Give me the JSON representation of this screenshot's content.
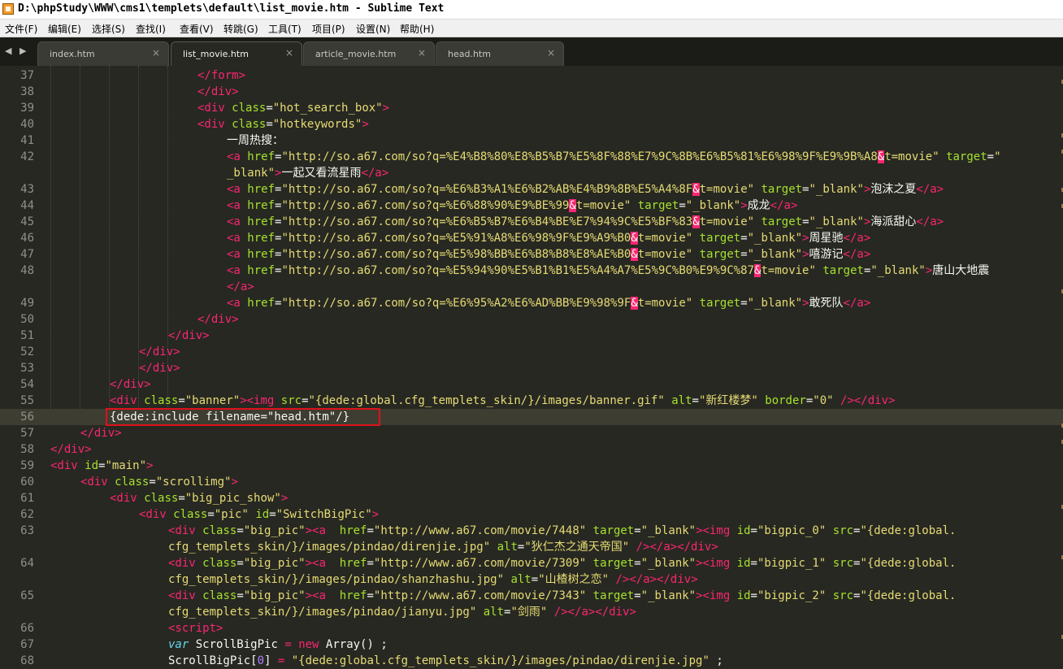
{
  "window": {
    "title": "D:\\phpStudy\\WWW\\cms1\\templets\\default\\list_movie.htm - Sublime Text"
  },
  "menu": {
    "items": [
      "文件(F)",
      "编辑(E)",
      "选择(S)",
      "查找(I)",
      "查看(V)",
      "转跳(G)",
      "工具(T)",
      "项目(P)",
      "设置(N)",
      "帮助(H)"
    ]
  },
  "tabs": [
    {
      "label": "index.htm",
      "active": false
    },
    {
      "label": "list_movie.htm",
      "active": true
    },
    {
      "label": "article_movie.htm",
      "active": false
    },
    {
      "label": "head.htm",
      "active": false
    }
  ],
  "icons": {
    "app": "sublime-text-icon",
    "tab_close": "close-icon",
    "nav": "tab-nav-arrows-icon"
  },
  "colors": {
    "background": "#272822",
    "tag": "#f92672",
    "attribute": "#a6e22e",
    "string": "#e6db74",
    "keyword": "#66d9ef",
    "number": "#ae81ff",
    "highlight_box": "#e0101a"
  },
  "editor": {
    "highlighted_line": 56,
    "line_numbers": [
      "37",
      "38",
      "39",
      "40",
      "41",
      "42",
      "",
      "43",
      "44",
      "45",
      "46",
      "47",
      "48",
      "",
      "49",
      "50",
      "51",
      "52",
      "53",
      "54",
      "55",
      "56",
      "57",
      "58",
      "59",
      "60",
      "61",
      "62",
      "63",
      "",
      "64",
      "",
      "65",
      "",
      "66",
      "67",
      "68"
    ],
    "rows": [
      [
        [
          "t",
          "</form>"
        ]
      ],
      [
        [
          "t",
          "</div>"
        ]
      ],
      [
        [
          "t",
          "<div "
        ],
        [
          "a",
          "class"
        ],
        [
          "",
          "="
        ],
        [
          "s",
          "\"hot_search_box\""
        ],
        [
          "t",
          ">"
        ]
      ],
      [
        [
          "t",
          "<div "
        ],
        [
          "a",
          "class"
        ],
        [
          "",
          "="
        ],
        [
          "s",
          "\"hotkeywords\""
        ],
        [
          "t",
          ">"
        ]
      ],
      [
        [
          "",
          "一周热搜："
        ]
      ],
      [
        [
          "t",
          "<a "
        ],
        [
          "a",
          "href"
        ],
        [
          "",
          "="
        ],
        [
          "s",
          "\"http://so.a67.com/so?q=%E4%B8%80%E8%B5%B7%E5%8F%88%E7%9C%8B%E6%B5%81%E6%98%9F%E9%9B%A8"
        ],
        [
          "err",
          "&"
        ],
        [
          "s",
          "t=movie\""
        ],
        [
          "",
          " "
        ],
        [
          "a",
          "target"
        ],
        [
          "",
          "="
        ],
        [
          "s",
          "\""
        ]
      ],
      [
        [
          "s",
          "_blank\""
        ],
        [
          "t",
          ">"
        ],
        [
          "",
          "一起又看流星雨"
        ],
        [
          "t",
          "</a>"
        ]
      ],
      [
        [
          "t",
          "<a "
        ],
        [
          "a",
          "href"
        ],
        [
          "",
          "="
        ],
        [
          "s",
          "\"http://so.a67.com/so?q=%E6%B3%A1%E6%B2%AB%E4%B9%8B%E5%A4%8F"
        ],
        [
          "err",
          "&"
        ],
        [
          "s",
          "t=movie\""
        ],
        [
          "",
          " "
        ],
        [
          "a",
          "target"
        ],
        [
          "",
          "="
        ],
        [
          "s",
          "\"_blank\""
        ],
        [
          "t",
          ">"
        ],
        [
          "",
          "泡沫之夏"
        ],
        [
          "t",
          "</a>"
        ]
      ],
      [
        [
          "t",
          "<a "
        ],
        [
          "a",
          "href"
        ],
        [
          "",
          "="
        ],
        [
          "s",
          "\"http://so.a67.com/so?q=%E6%88%90%E9%BE%99"
        ],
        [
          "err",
          "&"
        ],
        [
          "s",
          "t=movie\""
        ],
        [
          "",
          " "
        ],
        [
          "a",
          "target"
        ],
        [
          "",
          "="
        ],
        [
          "s",
          "\"_blank\""
        ],
        [
          "t",
          ">"
        ],
        [
          "",
          "成龙"
        ],
        [
          "t",
          "</a>"
        ]
      ],
      [
        [
          "t",
          "<a "
        ],
        [
          "a",
          "href"
        ],
        [
          "",
          "="
        ],
        [
          "s",
          "\"http://so.a67.com/so?q=%E6%B5%B7%E6%B4%BE%E7%94%9C%E5%BF%83"
        ],
        [
          "err",
          "&"
        ],
        [
          "s",
          "t=movie\""
        ],
        [
          "",
          " "
        ],
        [
          "a",
          "target"
        ],
        [
          "",
          "="
        ],
        [
          "s",
          "\"_blank\""
        ],
        [
          "t",
          ">"
        ],
        [
          "",
          "海派甜心"
        ],
        [
          "t",
          "</a>"
        ]
      ],
      [
        [
          "t",
          "<a "
        ],
        [
          "a",
          "href"
        ],
        [
          "",
          "="
        ],
        [
          "s",
          "\"http://so.a67.com/so?q=%E5%91%A8%E6%98%9F%E9%A9%B0"
        ],
        [
          "err",
          "&"
        ],
        [
          "s",
          "t=movie\""
        ],
        [
          "",
          " "
        ],
        [
          "a",
          "target"
        ],
        [
          "",
          "="
        ],
        [
          "s",
          "\"_blank\""
        ],
        [
          "t",
          ">"
        ],
        [
          "",
          "周星驰"
        ],
        [
          "t",
          "</a>"
        ]
      ],
      [
        [
          "t",
          "<a "
        ],
        [
          "a",
          "href"
        ],
        [
          "",
          "="
        ],
        [
          "s",
          "\"http://so.a67.com/so?q=%E5%98%BB%E6%B8%B8%E8%AE%B0"
        ],
        [
          "err",
          "&"
        ],
        [
          "s",
          "t=movie\""
        ],
        [
          "",
          " "
        ],
        [
          "a",
          "target"
        ],
        [
          "",
          "="
        ],
        [
          "s",
          "\"_blank\""
        ],
        [
          "t",
          ">"
        ],
        [
          "",
          "嘻游记"
        ],
        [
          "t",
          "</a>"
        ]
      ],
      [
        [
          "t",
          "<a "
        ],
        [
          "a",
          "href"
        ],
        [
          "",
          "="
        ],
        [
          "s",
          "\"http://so.a67.com/so?q=%E5%94%90%E5%B1%B1%E5%A4%A7%E5%9C%B0%E9%9C%87"
        ],
        [
          "err",
          "&"
        ],
        [
          "s",
          "t=movie\""
        ],
        [
          "",
          " "
        ],
        [
          "a",
          "target"
        ],
        [
          "",
          "="
        ],
        [
          "s",
          "\"_blank\""
        ],
        [
          "t",
          ">"
        ],
        [
          "",
          "唐山大地震"
        ]
      ],
      [
        [
          "t",
          "</a>"
        ]
      ],
      [
        [
          "t",
          "<a "
        ],
        [
          "a",
          "href"
        ],
        [
          "",
          "="
        ],
        [
          "s",
          "\"http://so.a67.com/so?q=%E6%95%A2%E6%AD%BB%E9%98%9F"
        ],
        [
          "err",
          "&"
        ],
        [
          "s",
          "t=movie\""
        ],
        [
          "",
          " "
        ],
        [
          "a",
          "target"
        ],
        [
          "",
          "="
        ],
        [
          "s",
          "\"_blank\""
        ],
        [
          "t",
          ">"
        ],
        [
          "",
          "敢死队"
        ],
        [
          "t",
          "</a>"
        ]
      ],
      [
        [
          "t",
          "</div>"
        ]
      ],
      [
        [
          "t",
          "</div>"
        ]
      ],
      [
        [
          "t",
          "</div>"
        ]
      ],
      [
        [
          "t",
          "</div>"
        ]
      ],
      [
        [
          "t",
          "</div>"
        ]
      ],
      [
        [
          "t",
          "<div "
        ],
        [
          "a",
          "class"
        ],
        [
          "",
          "="
        ],
        [
          "s",
          "\"banner\""
        ],
        [
          "t",
          "><img "
        ],
        [
          "a",
          "src"
        ],
        [
          "",
          "="
        ],
        [
          "s",
          "\"{dede:global.cfg_templets_skin/}/images/banner.gif\""
        ],
        [
          "",
          " "
        ],
        [
          "a",
          "alt"
        ],
        [
          "",
          "="
        ],
        [
          "s",
          "\"新红楼梦\""
        ],
        [
          "",
          " "
        ],
        [
          "a",
          "border"
        ],
        [
          "",
          "="
        ],
        [
          "s",
          "\"0\""
        ],
        [
          "",
          " "
        ],
        [
          "t",
          "/></div>"
        ]
      ],
      [
        [
          "",
          "{dede:include "
        ],
        [
          "",
          "filename"
        ],
        [
          "",
          "="
        ],
        [
          "",
          "\"head.htm\""
        ],
        [
          "",
          "/}"
        ]
      ],
      [
        [
          "t",
          "</div>"
        ]
      ],
      [
        [
          "t",
          "</div>"
        ]
      ],
      [
        [
          "t",
          "<div "
        ],
        [
          "a",
          "id"
        ],
        [
          "",
          "="
        ],
        [
          "s",
          "\"main\""
        ],
        [
          "t",
          ">"
        ]
      ],
      [
        [
          "t",
          "<div "
        ],
        [
          "a",
          "class"
        ],
        [
          "",
          "="
        ],
        [
          "s",
          "\"scrollimg\""
        ],
        [
          "t",
          ">"
        ]
      ],
      [
        [
          "t",
          "<div "
        ],
        [
          "a",
          "class"
        ],
        [
          "",
          "="
        ],
        [
          "s",
          "\"big_pic_show\""
        ],
        [
          "t",
          ">"
        ]
      ],
      [
        [
          "t",
          "<div "
        ],
        [
          "a",
          "class"
        ],
        [
          "",
          "="
        ],
        [
          "s",
          "\"pic\""
        ],
        [
          "",
          " "
        ],
        [
          "a",
          "id"
        ],
        [
          "",
          "="
        ],
        [
          "s",
          "\"SwitchBigPic\""
        ],
        [
          "t",
          ">"
        ]
      ],
      [
        [
          "t",
          "<div "
        ],
        [
          "a",
          "class"
        ],
        [
          "",
          "="
        ],
        [
          "s",
          "\"big_pic\""
        ],
        [
          "t",
          "><a  "
        ],
        [
          "a",
          "href"
        ],
        [
          "",
          "="
        ],
        [
          "s",
          "\"http://www.a67.com/movie/7448\""
        ],
        [
          "",
          " "
        ],
        [
          "a",
          "target"
        ],
        [
          "",
          "="
        ],
        [
          "s",
          "\"_blank\""
        ],
        [
          "t",
          "><img "
        ],
        [
          "a",
          "id"
        ],
        [
          "",
          "="
        ],
        [
          "s",
          "\"bigpic_0\""
        ],
        [
          "",
          " "
        ],
        [
          "a",
          "src"
        ],
        [
          "",
          "="
        ],
        [
          "s",
          "\"{dede:global."
        ]
      ],
      [
        [
          "s",
          "cfg_templets_skin/}/images/pindao/direnjie.jpg\""
        ],
        [
          "",
          " "
        ],
        [
          "a",
          "alt"
        ],
        [
          "",
          "="
        ],
        [
          "s",
          "\"狄仁杰之通天帝国\""
        ],
        [
          "",
          " "
        ],
        [
          "t",
          "/></a></div>"
        ]
      ],
      [
        [
          "t",
          "<div "
        ],
        [
          "a",
          "class"
        ],
        [
          "",
          "="
        ],
        [
          "s",
          "\"big_pic\""
        ],
        [
          "t",
          "><a  "
        ],
        [
          "a",
          "href"
        ],
        [
          "",
          "="
        ],
        [
          "s",
          "\"http://www.a67.com/movie/7309\""
        ],
        [
          "",
          " "
        ],
        [
          "a",
          "target"
        ],
        [
          "",
          "="
        ],
        [
          "s",
          "\"_blank\""
        ],
        [
          "t",
          "><img "
        ],
        [
          "a",
          "id"
        ],
        [
          "",
          "="
        ],
        [
          "s",
          "\"bigpic_1\""
        ],
        [
          "",
          " "
        ],
        [
          "a",
          "src"
        ],
        [
          "",
          "="
        ],
        [
          "s",
          "\"{dede:global."
        ]
      ],
      [
        [
          "s",
          "cfg_templets_skin/}/images/pindao/shanzhashu.jpg\""
        ],
        [
          "",
          " "
        ],
        [
          "a",
          "alt"
        ],
        [
          "",
          "="
        ],
        [
          "s",
          "\"山楂树之恋\""
        ],
        [
          "",
          " "
        ],
        [
          "t",
          "/></a></div>"
        ]
      ],
      [
        [
          "t",
          "<div "
        ],
        [
          "a",
          "class"
        ],
        [
          "",
          "="
        ],
        [
          "s",
          "\"big_pic\""
        ],
        [
          "t",
          "><a  "
        ],
        [
          "a",
          "href"
        ],
        [
          "",
          "="
        ],
        [
          "s",
          "\"http://www.a67.com/movie/7343\""
        ],
        [
          "",
          " "
        ],
        [
          "a",
          "target"
        ],
        [
          "",
          "="
        ],
        [
          "s",
          "\"_blank\""
        ],
        [
          "t",
          "><img "
        ],
        [
          "a",
          "id"
        ],
        [
          "",
          "="
        ],
        [
          "s",
          "\"bigpic_2\""
        ],
        [
          "",
          " "
        ],
        [
          "a",
          "src"
        ],
        [
          "",
          "="
        ],
        [
          "s",
          "\"{dede:global."
        ]
      ],
      [
        [
          "s",
          "cfg_templets_skin/}/images/pindao/jianyu.jpg\""
        ],
        [
          "",
          " "
        ],
        [
          "a",
          "alt"
        ],
        [
          "",
          "="
        ],
        [
          "s",
          "\"剑雨\""
        ],
        [
          "",
          " "
        ],
        [
          "t",
          "/></a></div>"
        ]
      ],
      [
        [
          "t",
          "<script>"
        ]
      ],
      [
        [
          "k",
          "var"
        ],
        [
          "",
          " ScrollBigPic "
        ],
        [
          "t",
          "="
        ],
        [
          "",
          " "
        ],
        [
          "t",
          "new"
        ],
        [
          "",
          " Array() ;"
        ]
      ],
      [
        [
          "",
          "ScrollBigPic["
        ],
        [
          "n",
          "0"
        ],
        [
          "",
          "] "
        ],
        [
          "t",
          "="
        ],
        [
          "",
          " "
        ],
        [
          "s",
          "\"{dede:global.cfg_templets_skin/}/images/pindao/direnjie.jpg\""
        ],
        [
          "",
          " ;"
        ]
      ]
    ]
  }
}
